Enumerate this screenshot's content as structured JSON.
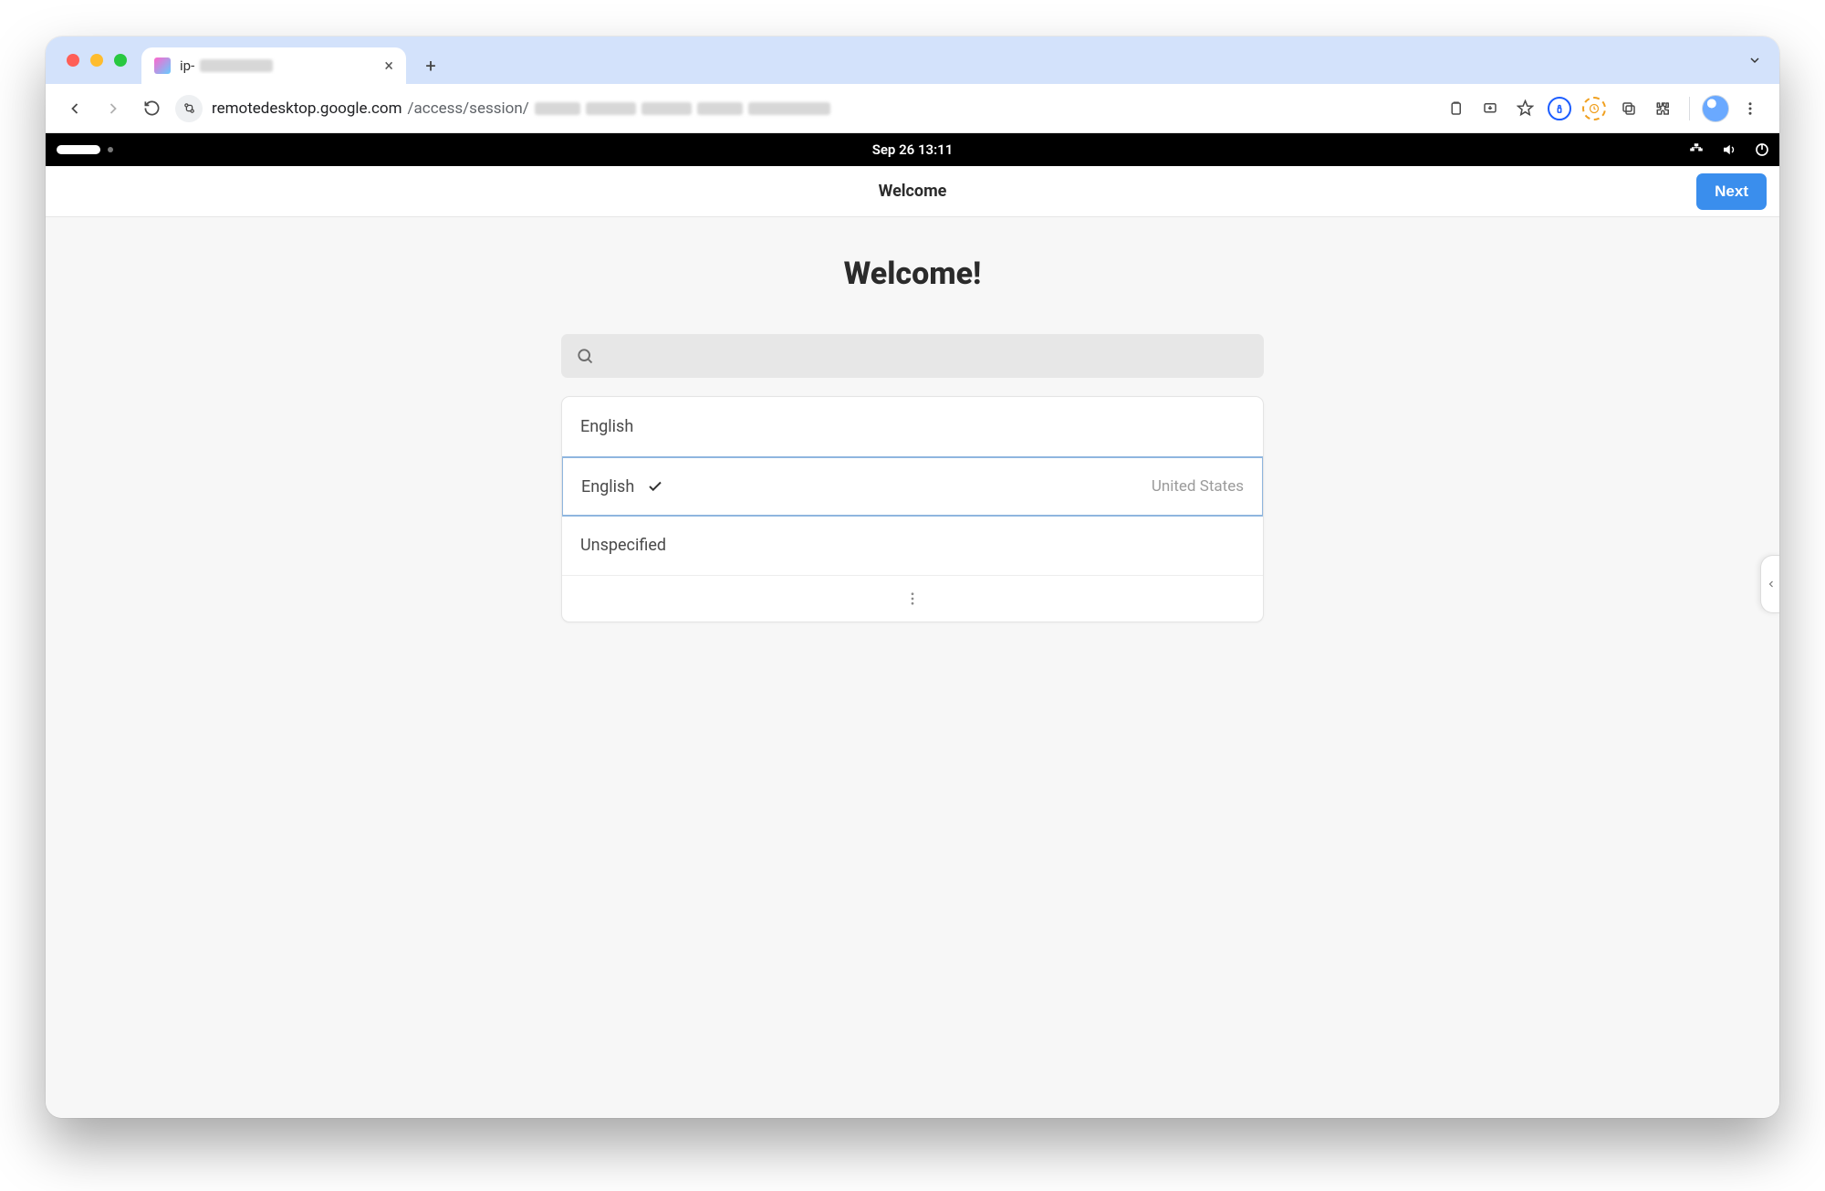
{
  "browser": {
    "tab_title_prefix": "ip-",
    "url_host": "remotedesktop.google.com",
    "url_path": "/access/session/"
  },
  "remote_bar": {
    "datetime": "Sep 26  13:11"
  },
  "app": {
    "header_title": "Welcome",
    "next_label": "Next",
    "hero": "Welcome!",
    "search_placeholder": "",
    "languages": [
      {
        "label": "English",
        "sub": "",
        "selected": false
      },
      {
        "label": "English",
        "sub": "United States",
        "selected": true
      },
      {
        "label": "Unspecified",
        "sub": "",
        "selected": false
      }
    ]
  }
}
